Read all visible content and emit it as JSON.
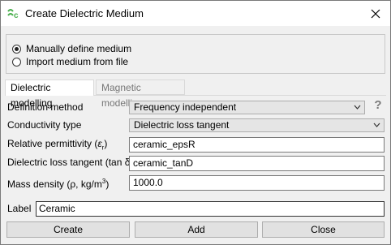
{
  "window": {
    "title": "Create Dielectric Medium"
  },
  "medium_source": {
    "options": [
      {
        "label": "Manually define medium",
        "checked": true
      },
      {
        "label": "Import medium from file",
        "checked": false
      }
    ]
  },
  "tabs": [
    {
      "label": "Dielectric modelling",
      "active": true
    },
    {
      "label": "Magnetic modelling",
      "active": false
    }
  ],
  "form": {
    "definition_method": {
      "label": "Definition method",
      "value": "Frequency independent"
    },
    "conductivity_type": {
      "label": "Conductivity type",
      "value": "Dielectric loss tangent"
    },
    "relative_permittivity": {
      "label": "Relative permittivity (",
      "symbol": "ε",
      "sub": "r",
      "tail": ")",
      "value": "ceramic_epsR"
    },
    "loss_tangent": {
      "label": "Dielectric loss tangent (tan δ)",
      "value": "ceramic_tanD"
    },
    "mass_density": {
      "label": "Mass density (ρ, kg/m",
      "sup": "3",
      "tail": ")",
      "value": "1000.0"
    },
    "help_glyph": "?"
  },
  "label_field": {
    "label": "Label",
    "value": "Ceramic"
  },
  "buttons": {
    "create": "Create",
    "add": "Add",
    "close": "Close"
  },
  "colors": {
    "window_bg": "#f0f0f0",
    "titlebar_bg": "#ffffff",
    "icon_green": "#4caf50"
  }
}
